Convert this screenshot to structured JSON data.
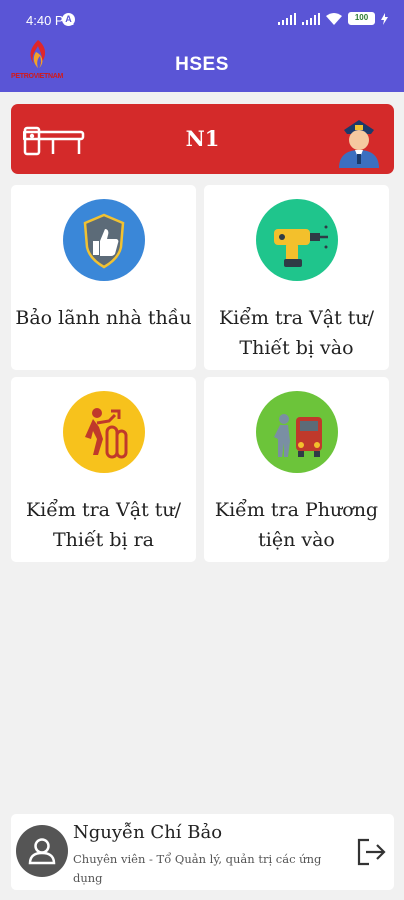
{
  "status_bar": {
    "time": "4:40 PM",
    "sync_glyph": "A",
    "battery": "100"
  },
  "header": {
    "logo_text": "PETROVIETNAM",
    "title": "HSES"
  },
  "station": {
    "label": "N1",
    "color": "#d42a2a"
  },
  "menu": [
    {
      "label": "Bảo lãnh nhà thầu",
      "icon": "thumbs-up-shield-icon",
      "circle_color": "#3a87d8"
    },
    {
      "label_line1": "Kiểm tra Vật tư/",
      "label_line2": "Thiết bị vào",
      "icon": "drill-icon",
      "circle_color": "#1fc58c"
    },
    {
      "label_line1": "Kiểm tra Vật tư/",
      "label_line2": "Thiết bị ra",
      "icon": "worker-tires-icon",
      "circle_color": "#f7c21c"
    },
    {
      "label_line1": "Kiểm tra Phương",
      "label_line2": "tiện vào",
      "icon": "person-car-icon",
      "circle_color": "#6cc43a"
    }
  ],
  "user": {
    "name": "Nguyễn Chí Bảo",
    "role": "Chuyên viên - Tổ Quản lý, quản trị các ứng dụng"
  },
  "colors": {
    "header_bg": "#5a55d6",
    "page_bg": "#f1f1f1"
  }
}
